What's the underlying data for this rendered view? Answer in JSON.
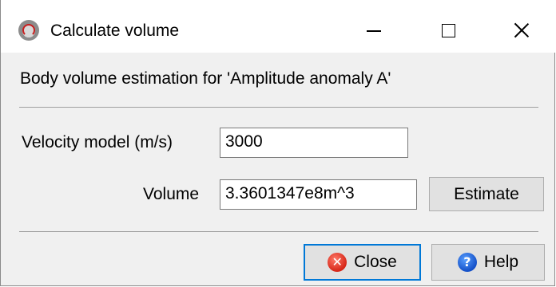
{
  "window": {
    "title": "Calculate volume",
    "controls": {
      "minimize": "minimize-icon",
      "maximize": "maximize-icon",
      "close": "close-icon"
    }
  },
  "dialog": {
    "header": "Body volume estimation for 'Amplitude anomaly A'",
    "velocity": {
      "label": "Velocity model (m/s)",
      "value": "3000"
    },
    "volume": {
      "label": "Volume",
      "value": "3.3601347e8m^3"
    },
    "estimate_label": "Estimate"
  },
  "footer": {
    "close_label": "Close",
    "help_label": "Help",
    "close_icon_glyph": "✕",
    "help_icon_glyph": "?"
  },
  "colors": {
    "focus_border": "#0078d7",
    "close_icon": "#d62617",
    "help_icon": "#1450c8"
  }
}
